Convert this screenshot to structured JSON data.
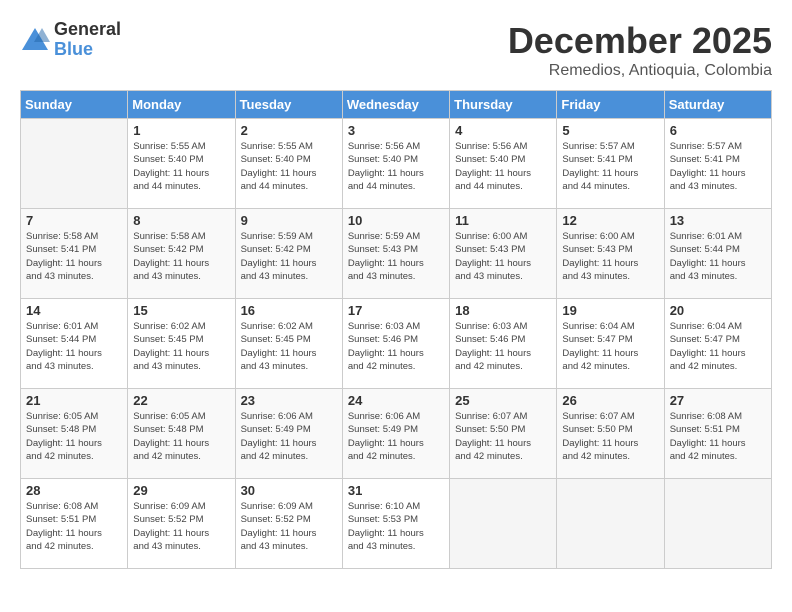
{
  "logo": {
    "general": "General",
    "blue": "Blue"
  },
  "title": "December 2025",
  "subtitle": "Remedios, Antioquia, Colombia",
  "days_header": [
    "Sunday",
    "Monday",
    "Tuesday",
    "Wednesday",
    "Thursday",
    "Friday",
    "Saturday"
  ],
  "weeks": [
    [
      {
        "day": "",
        "info": ""
      },
      {
        "day": "1",
        "info": "Sunrise: 5:55 AM\nSunset: 5:40 PM\nDaylight: 11 hours\nand 44 minutes."
      },
      {
        "day": "2",
        "info": "Sunrise: 5:55 AM\nSunset: 5:40 PM\nDaylight: 11 hours\nand 44 minutes."
      },
      {
        "day": "3",
        "info": "Sunrise: 5:56 AM\nSunset: 5:40 PM\nDaylight: 11 hours\nand 44 minutes."
      },
      {
        "day": "4",
        "info": "Sunrise: 5:56 AM\nSunset: 5:40 PM\nDaylight: 11 hours\nand 44 minutes."
      },
      {
        "day": "5",
        "info": "Sunrise: 5:57 AM\nSunset: 5:41 PM\nDaylight: 11 hours\nand 44 minutes."
      },
      {
        "day": "6",
        "info": "Sunrise: 5:57 AM\nSunset: 5:41 PM\nDaylight: 11 hours\nand 43 minutes."
      }
    ],
    [
      {
        "day": "7",
        "info": "Sunrise: 5:58 AM\nSunset: 5:41 PM\nDaylight: 11 hours\nand 43 minutes."
      },
      {
        "day": "8",
        "info": "Sunrise: 5:58 AM\nSunset: 5:42 PM\nDaylight: 11 hours\nand 43 minutes."
      },
      {
        "day": "9",
        "info": "Sunrise: 5:59 AM\nSunset: 5:42 PM\nDaylight: 11 hours\nand 43 minutes."
      },
      {
        "day": "10",
        "info": "Sunrise: 5:59 AM\nSunset: 5:43 PM\nDaylight: 11 hours\nand 43 minutes."
      },
      {
        "day": "11",
        "info": "Sunrise: 6:00 AM\nSunset: 5:43 PM\nDaylight: 11 hours\nand 43 minutes."
      },
      {
        "day": "12",
        "info": "Sunrise: 6:00 AM\nSunset: 5:43 PM\nDaylight: 11 hours\nand 43 minutes."
      },
      {
        "day": "13",
        "info": "Sunrise: 6:01 AM\nSunset: 5:44 PM\nDaylight: 11 hours\nand 43 minutes."
      }
    ],
    [
      {
        "day": "14",
        "info": "Sunrise: 6:01 AM\nSunset: 5:44 PM\nDaylight: 11 hours\nand 43 minutes."
      },
      {
        "day": "15",
        "info": "Sunrise: 6:02 AM\nSunset: 5:45 PM\nDaylight: 11 hours\nand 43 minutes."
      },
      {
        "day": "16",
        "info": "Sunrise: 6:02 AM\nSunset: 5:45 PM\nDaylight: 11 hours\nand 43 minutes."
      },
      {
        "day": "17",
        "info": "Sunrise: 6:03 AM\nSunset: 5:46 PM\nDaylight: 11 hours\nand 42 minutes."
      },
      {
        "day": "18",
        "info": "Sunrise: 6:03 AM\nSunset: 5:46 PM\nDaylight: 11 hours\nand 42 minutes."
      },
      {
        "day": "19",
        "info": "Sunrise: 6:04 AM\nSunset: 5:47 PM\nDaylight: 11 hours\nand 42 minutes."
      },
      {
        "day": "20",
        "info": "Sunrise: 6:04 AM\nSunset: 5:47 PM\nDaylight: 11 hours\nand 42 minutes."
      }
    ],
    [
      {
        "day": "21",
        "info": "Sunrise: 6:05 AM\nSunset: 5:48 PM\nDaylight: 11 hours\nand 42 minutes."
      },
      {
        "day": "22",
        "info": "Sunrise: 6:05 AM\nSunset: 5:48 PM\nDaylight: 11 hours\nand 42 minutes."
      },
      {
        "day": "23",
        "info": "Sunrise: 6:06 AM\nSunset: 5:49 PM\nDaylight: 11 hours\nand 42 minutes."
      },
      {
        "day": "24",
        "info": "Sunrise: 6:06 AM\nSunset: 5:49 PM\nDaylight: 11 hours\nand 42 minutes."
      },
      {
        "day": "25",
        "info": "Sunrise: 6:07 AM\nSunset: 5:50 PM\nDaylight: 11 hours\nand 42 minutes."
      },
      {
        "day": "26",
        "info": "Sunrise: 6:07 AM\nSunset: 5:50 PM\nDaylight: 11 hours\nand 42 minutes."
      },
      {
        "day": "27",
        "info": "Sunrise: 6:08 AM\nSunset: 5:51 PM\nDaylight: 11 hours\nand 42 minutes."
      }
    ],
    [
      {
        "day": "28",
        "info": "Sunrise: 6:08 AM\nSunset: 5:51 PM\nDaylight: 11 hours\nand 42 minutes."
      },
      {
        "day": "29",
        "info": "Sunrise: 6:09 AM\nSunset: 5:52 PM\nDaylight: 11 hours\nand 43 minutes."
      },
      {
        "day": "30",
        "info": "Sunrise: 6:09 AM\nSunset: 5:52 PM\nDaylight: 11 hours\nand 43 minutes."
      },
      {
        "day": "31",
        "info": "Sunrise: 6:10 AM\nSunset: 5:53 PM\nDaylight: 11 hours\nand 43 minutes."
      },
      {
        "day": "",
        "info": ""
      },
      {
        "day": "",
        "info": ""
      },
      {
        "day": "",
        "info": ""
      }
    ]
  ]
}
